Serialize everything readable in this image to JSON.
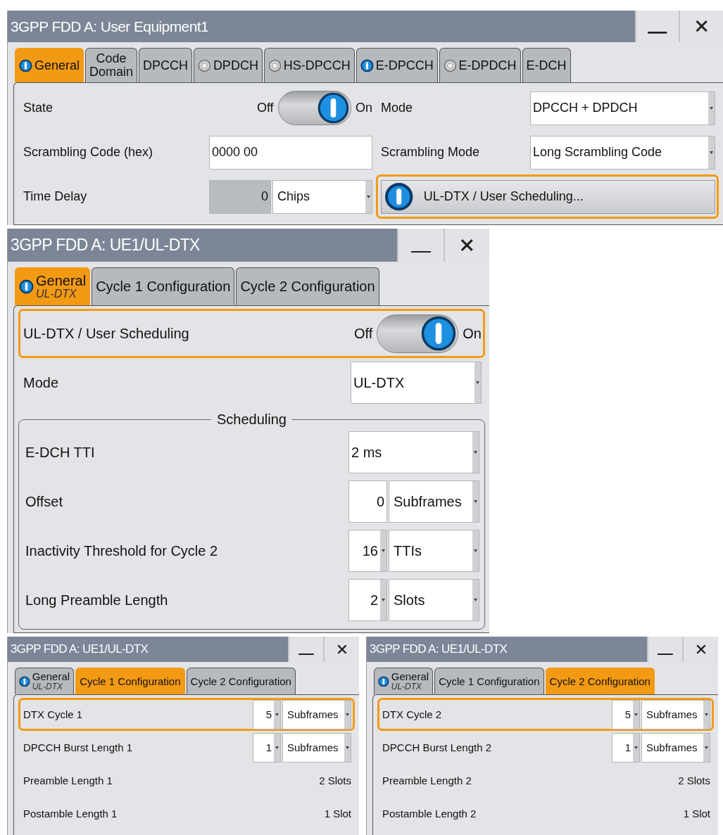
{
  "windows": [
    {
      "title": "3GPP FDD A: User Equipment1",
      "tabs": [
        {
          "label": "General",
          "indicator": true,
          "selected": true
        },
        {
          "label": "Code\nDomain",
          "selected": false
        },
        {
          "label": "DPCCH",
          "selected": false
        },
        {
          "label": "DPDCH",
          "indicator": false,
          "selected": false
        },
        {
          "label": "HS-DPCCH",
          "indicator": false,
          "selected": false
        },
        {
          "label": "E-DPCCH",
          "indicator": true,
          "selected": false
        },
        {
          "label": "E-DPDCH",
          "indicator": false,
          "selected": false
        },
        {
          "label": "E-DCH",
          "selected": false
        }
      ],
      "columns": [
        [
          {
            "kind": "toggle",
            "label": "State",
            "off_label": "Off",
            "on_label": "On",
            "on": true,
            "highlighted": false
          },
          {
            "kind": "text",
            "label": "Scrambling Code (hex)",
            "value": "0000 00",
            "highlighted": false
          },
          {
            "kind": "value_unit",
            "label": "Time Delay",
            "value": "0",
            "unit": "Chips",
            "value_caret": false,
            "disabled": true,
            "highlighted": false
          }
        ],
        [
          {
            "kind": "dropdown",
            "label": "Mode",
            "value": "DPCCH + DPDCH",
            "highlighted": false
          },
          {
            "kind": "dropdown",
            "label": "Scrambling Mode",
            "value": "Long Scrambling Code",
            "highlighted": false
          },
          {
            "kind": "button",
            "label": "UL-DTX / User Scheduling...",
            "indicator": true,
            "highlighted": true
          }
        ]
      ]
    },
    {
      "title": "3GPP FDD A: UE1/UL-DTX",
      "tabs": [
        {
          "label": "General",
          "sublabel": "UL-DTX",
          "indicator": true,
          "selected": true
        },
        {
          "label": "Cycle 1 Configuration",
          "selected": false
        },
        {
          "label": "Cycle 2 Configuration",
          "selected": false
        }
      ],
      "fields": [
        {
          "kind": "toggle",
          "label": "UL-DTX / User Scheduling",
          "off_label": "Off",
          "on_label": "On",
          "on": true,
          "highlighted": true
        },
        {
          "kind": "dropdown",
          "label": "Mode",
          "value": "UL-DTX",
          "highlighted": false
        }
      ],
      "group": {
        "title": "Scheduling",
        "fields": [
          {
            "kind": "dropdown",
            "label": "E-DCH TTI",
            "value": "2 ms",
            "highlighted": false
          },
          {
            "kind": "value_unit",
            "label": "Offset",
            "value": "0",
            "unit": "Subframes",
            "value_caret": false,
            "disabled": false,
            "highlighted": false
          },
          {
            "kind": "value_unit",
            "label": "Inactivity Threshold for Cycle 2",
            "value": "16",
            "unit": "TTIs",
            "value_caret": true,
            "disabled": false,
            "highlighted": false
          },
          {
            "kind": "value_unit",
            "label": "Long Preamble Length",
            "value": "2",
            "unit": "Slots",
            "value_caret": true,
            "disabled": false,
            "highlighted": false
          }
        ]
      }
    },
    {
      "title": "3GPP FDD A: UE1/UL-DTX",
      "tabs": [
        {
          "label": "General",
          "sublabel": "UL-DTX",
          "indicator": true,
          "selected": false
        },
        {
          "label": "Cycle 1 Configuration",
          "selected": true
        },
        {
          "label": "Cycle 2 Configuration",
          "selected": false
        }
      ],
      "fields": [
        {
          "kind": "value_unit",
          "label": "DTX Cycle 1",
          "value": "5",
          "unit": "Subframes",
          "value_caret": true,
          "disabled": false,
          "highlighted": true
        },
        {
          "kind": "value_unit",
          "label": "DPCCH Burst Length 1",
          "value": "1",
          "unit": "Subframes",
          "value_caret": true,
          "disabled": false,
          "highlighted": false
        },
        {
          "kind": "readout",
          "label": "Preamble Length 1",
          "value": "2 Slots",
          "highlighted": false
        },
        {
          "kind": "readout",
          "label": "Postamble Length 1",
          "value": "1 Slot",
          "highlighted": false
        }
      ]
    },
    {
      "title": "3GPP FDD A: UE1/UL-DTX",
      "tabs": [
        {
          "label": "General",
          "sublabel": "UL-DTX",
          "indicator": true,
          "selected": false
        },
        {
          "label": "Cycle 1 Configuration",
          "selected": false
        },
        {
          "label": "Cycle 2 Configuration",
          "selected": true
        }
      ],
      "fields": [
        {
          "kind": "value_unit",
          "label": "DTX Cycle 2",
          "value": "5",
          "unit": "Subframes",
          "value_caret": true,
          "disabled": false,
          "highlighted": true
        },
        {
          "kind": "value_unit",
          "label": "DPCCH Burst Length 2",
          "value": "1",
          "unit": "Subframes",
          "value_caret": true,
          "disabled": false,
          "highlighted": false
        },
        {
          "kind": "readout",
          "label": "Preamble Length 2",
          "value": "2 Slots",
          "highlighted": false
        },
        {
          "kind": "readout",
          "label": "Postamble Length 2",
          "value": "1 Slot",
          "highlighted": false
        }
      ]
    }
  ]
}
